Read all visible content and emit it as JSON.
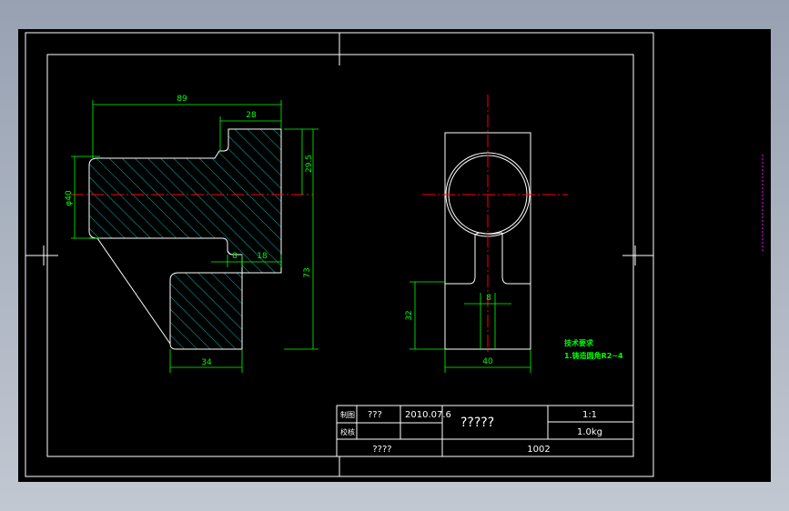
{
  "colors": {
    "background": "#000000",
    "frame": "#ffffff",
    "outline": "#ffffff",
    "dimension": "#00ff00",
    "hatch": "#00b4b4",
    "centerline": "#ff0000",
    "side_marker": "#ff00ff"
  },
  "side_view": {
    "dimensions": {
      "overall_width": "89",
      "top_width": "28",
      "diameter": "φ40",
      "top_height": "29.5",
      "total_height": "73",
      "slot_width": "8",
      "slot_offset": "18",
      "bottom_width": "34"
    }
  },
  "front_view": {
    "dimensions": {
      "slot_width": "8",
      "height": "32",
      "width": "40"
    }
  },
  "notes": {
    "title": "技术要求",
    "line1": "1.铸造圆角R2~4"
  },
  "title_block": {
    "label_drawn": "制图",
    "label_checked": "校核",
    "drawn_by": "???",
    "date": "2010.07.6",
    "part_name": "?????",
    "scale": "1:1",
    "weight": "1.0kg",
    "organization": "????",
    "drawing_number": "1002"
  }
}
